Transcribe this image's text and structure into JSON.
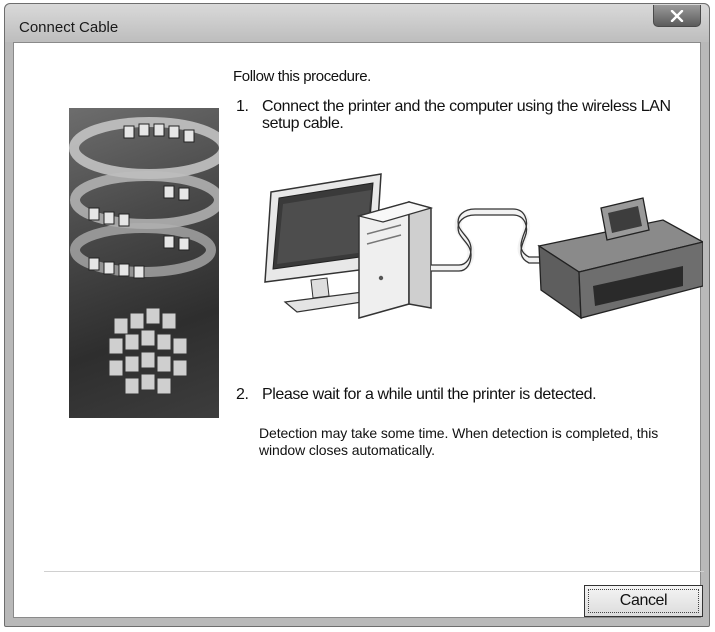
{
  "window": {
    "title": "Connect Cable"
  },
  "content": {
    "intro": "Follow this procedure.",
    "steps": [
      {
        "number": "1.",
        "text": "Connect the printer and the computer using the wireless LAN setup cable."
      },
      {
        "number": "2.",
        "text": "Please wait for a while until the printer is detected."
      }
    ],
    "note": "Detection may take some time. When detection is completed, this window closes automatically."
  },
  "buttons": {
    "cancel_label": "Cancel"
  },
  "icons": {
    "close": "close-icon"
  }
}
